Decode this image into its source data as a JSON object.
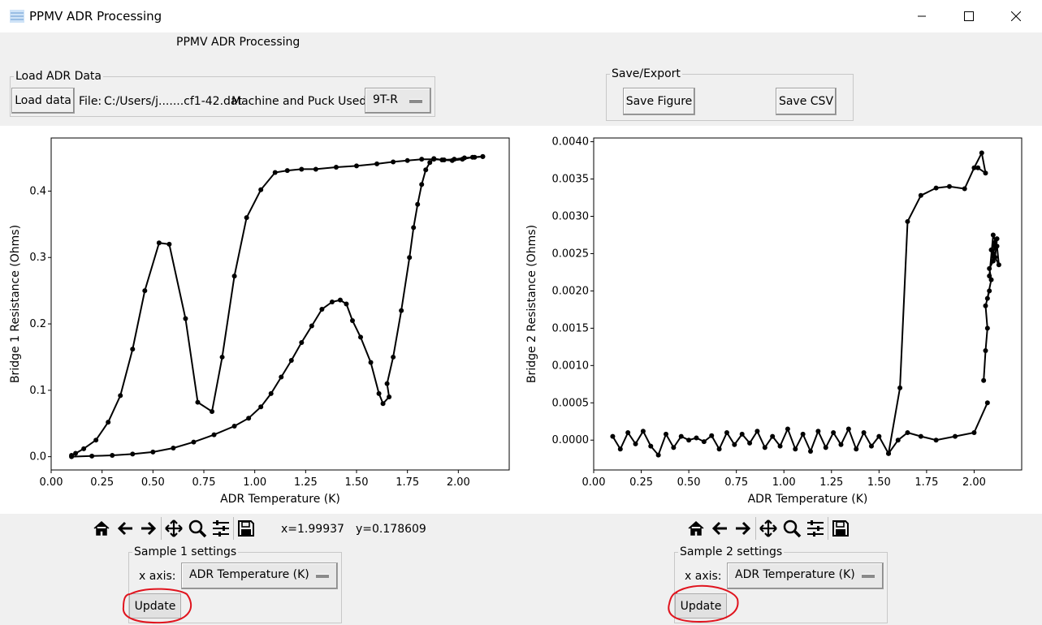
{
  "window": {
    "title": "PPMV ADR Processing"
  },
  "header_label": "PPMV ADR Processing",
  "load_group": {
    "legend": "Load ADR Data",
    "load_button": "Load data",
    "file_label": "File:",
    "file_value": "C:/Users/j.......cf1-42.dat",
    "machine_label": "Machine and Puck Used:",
    "machine_value": "9T-R"
  },
  "save_group": {
    "legend": "Save/Export",
    "save_figure": "Save Figure",
    "save_csv": "Save CSV"
  },
  "toolbar1": {
    "x_readout": "x=1.99937",
    "y_readout": "y=0.178609"
  },
  "sample1": {
    "legend": "Sample 1 settings",
    "xaxis_label": "x axis:",
    "xaxis_value": "ADR Temperature (K)",
    "update": "Update"
  },
  "sample2": {
    "legend": "Sample 2 settings",
    "xaxis_label": "x axis:",
    "xaxis_value": "ADR Temperature (K)",
    "update": "Update"
  },
  "icons": [
    "app-icon",
    "minimize-icon",
    "maximize-icon",
    "close-icon",
    "home-icon",
    "back-arrow-icon",
    "forward-arrow-icon",
    "pan-icon",
    "zoom-icon",
    "configure-icon",
    "save-icon"
  ],
  "annotation_color": "#e0141e",
  "chart_data": [
    {
      "type": "line",
      "xlabel": "ADR Temperature (K)",
      "ylabel": "Bridge 1 Resistance (Ohms)",
      "xlim": [
        0.0,
        2.25
      ],
      "ylim": [
        -0.02,
        0.48
      ],
      "xticks": [
        "0.00",
        "0.25",
        "0.50",
        "0.75",
        "1.00",
        "1.25",
        "1.50",
        "1.75",
        "2.00"
      ],
      "yticks": [
        "0.0",
        "0.1",
        "0.2",
        "0.3",
        "0.4"
      ],
      "xtick_values": [
        0.0,
        0.25,
        0.5,
        0.75,
        1.0,
        1.25,
        1.5,
        1.75,
        2.0
      ],
      "ytick_values": [
        0.0,
        0.1,
        0.2,
        0.3,
        0.4
      ],
      "color": "#000000",
      "series": [
        {
          "x": [
            0.1,
            0.12,
            0.16,
            0.22,
            0.28,
            0.34,
            0.4,
            0.46,
            0.53,
            0.58,
            0.66,
            0.72,
            0.79,
            0.84,
            0.9,
            0.96,
            1.03,
            1.1,
            1.16,
            1.23,
            1.3,
            1.4,
            1.5,
            1.6,
            1.68,
            1.75,
            1.82,
            1.88,
            1.93,
            1.98,
            2.03,
            2.08,
            2.12
          ],
          "y": [
            0.002,
            0.005,
            0.012,
            0.025,
            0.052,
            0.092,
            0.162,
            0.25,
            0.322,
            0.32,
            0.208,
            0.082,
            0.068,
            0.15,
            0.272,
            0.36,
            0.402,
            0.428,
            0.431,
            0.433,
            0.433,
            0.436,
            0.438,
            0.441,
            0.444,
            0.446,
            0.448,
            0.448,
            0.447,
            0.448,
            0.45,
            0.451,
            0.452
          ]
        },
        {
          "x": [
            0.1,
            0.2,
            0.3,
            0.4,
            0.5,
            0.6,
            0.7,
            0.8,
            0.9,
            0.97,
            1.03,
            1.08,
            1.13,
            1.18,
            1.23,
            1.28,
            1.33,
            1.38,
            1.42,
            1.45,
            1.48,
            1.52,
            1.57,
            1.61,
            1.63,
            1.66,
            1.65,
            1.68,
            1.72,
            1.76,
            1.78,
            1.8,
            1.82,
            1.84,
            1.86,
            1.88,
            1.92,
            1.97,
            2.02,
            2.07,
            2.12
          ],
          "y": [
            0.0,
            0.001,
            0.002,
            0.004,
            0.007,
            0.013,
            0.022,
            0.033,
            0.046,
            0.058,
            0.075,
            0.095,
            0.12,
            0.145,
            0.172,
            0.197,
            0.222,
            0.233,
            0.236,
            0.23,
            0.205,
            0.18,
            0.142,
            0.095,
            0.08,
            0.09,
            0.11,
            0.15,
            0.22,
            0.3,
            0.345,
            0.38,
            0.41,
            0.432,
            0.443,
            0.449,
            0.447,
            0.446,
            0.448,
            0.451,
            0.452
          ]
        }
      ]
    },
    {
      "type": "line",
      "xlabel": "ADR Temperature (K)",
      "ylabel": "Bridge 2 Resistance (Ohms)",
      "xlim": [
        0.0,
        2.25
      ],
      "ylim": [
        -0.0004,
        0.00405
      ],
      "xticks": [
        "0.00",
        "0.25",
        "0.50",
        "0.75",
        "1.00",
        "1.25",
        "1.50",
        "1.75",
        "2.00"
      ],
      "yticks": [
        "0.0000",
        "0.0005",
        "0.0010",
        "0.0015",
        "0.0020",
        "0.0025",
        "0.0030",
        "0.0035",
        "0.0040"
      ],
      "xtick_values": [
        0.0,
        0.25,
        0.5,
        0.75,
        1.0,
        1.25,
        1.5,
        1.75,
        2.0
      ],
      "ytick_values": [
        0.0,
        0.0005,
        0.001,
        0.0015,
        0.002,
        0.0025,
        0.003,
        0.0035,
        0.004
      ],
      "color": "#000000",
      "series": [
        {
          "x": [
            0.1,
            0.14,
            0.18,
            0.22,
            0.26,
            0.3,
            0.34,
            0.38,
            0.42,
            0.46,
            0.5,
            0.54,
            0.58,
            0.62,
            0.66,
            0.7,
            0.74,
            0.78,
            0.82,
            0.86,
            0.9,
            0.94,
            0.98,
            1.02,
            1.06,
            1.1,
            1.14,
            1.18,
            1.22,
            1.26,
            1.3,
            1.34,
            1.38,
            1.42,
            1.46,
            1.5,
            1.55,
            1.6,
            1.65,
            1.72,
            1.8,
            1.9,
            2.0,
            2.07
          ],
          "y": [
            5e-05,
            -0.00012,
            0.0001,
            -5e-05,
            0.00012,
            -8e-05,
            -0.0002,
            8e-05,
            -0.0001,
            5e-05,
            0.0,
            3e-05,
            -2e-05,
            6e-05,
            -0.00012,
            0.0001,
            -6e-05,
            8e-05,
            -4e-05,
            0.00012,
            -0.0001,
            5e-05,
            -8e-05,
            0.00015,
            -0.00012,
            8e-05,
            -0.00015,
            0.00012,
            -0.0001,
            0.0001,
            -6e-05,
            0.00015,
            -0.00012,
            0.0001,
            -8e-05,
            5e-05,
            -0.00018,
            0.0,
            0.0001,
            5e-05,
            0.0,
            5e-05,
            0.0001,
            0.0005
          ]
        },
        {
          "x": [
            1.55,
            1.61,
            1.65,
            1.72,
            1.8,
            1.87,
            1.95,
            2.0,
            2.04,
            2.06,
            2.02
          ],
          "y": [
            -0.00018,
            0.0007,
            0.00293,
            0.00328,
            0.00338,
            0.0034,
            0.00337,
            0.00365,
            0.00385,
            0.00358,
            0.00365
          ]
        },
        {
          "x": [
            2.05,
            2.06,
            2.07,
            2.06,
            2.08,
            2.07,
            2.09,
            2.08,
            2.1,
            2.09,
            2.11,
            2.1,
            2.12,
            2.11,
            2.13,
            2.12,
            2.1,
            2.08
          ],
          "y": [
            0.0008,
            0.0012,
            0.0015,
            0.0018,
            0.002,
            0.0019,
            0.00215,
            0.0023,
            0.0024,
            0.00255,
            0.00265,
            0.0025,
            0.0027,
            0.00245,
            0.00235,
            0.0026,
            0.00275,
            0.0022
          ]
        }
      ]
    }
  ]
}
